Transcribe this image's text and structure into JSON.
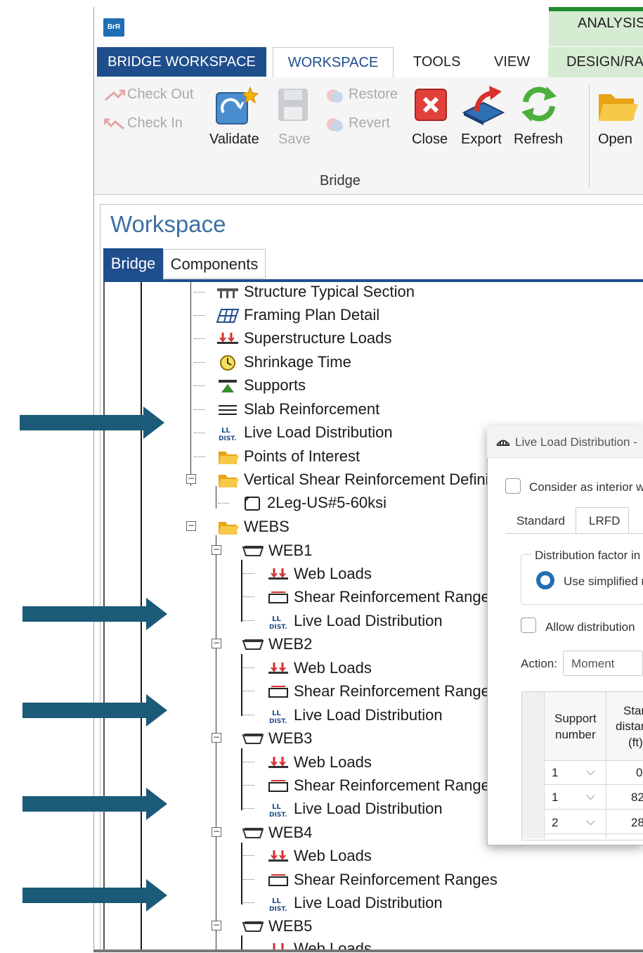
{
  "window": {
    "app_logo": "BrR",
    "analysis_tab": "ANALYSIS"
  },
  "ribbon": {
    "tabs": [
      "BRIDGE WORKSPACE",
      "WORKSPACE",
      "TOOLS",
      "VIEW",
      "DESIGN/RA"
    ],
    "check_out": "Check Out",
    "check_in": "Check In",
    "validate": "Validate",
    "save": "Save",
    "restore": "Restore",
    "revert": "Revert",
    "close": "Close",
    "export": "Export",
    "refresh": "Refresh",
    "open": "Open",
    "group_label": "Bridge"
  },
  "workspace": {
    "title": "Workspace",
    "tab_bridge": "Bridge",
    "tab_components": "Components"
  },
  "tree": {
    "structure_typical_section": "Structure Typical Section",
    "framing_plan_detail": "Framing Plan Detail",
    "superstructure_loads": "Superstructure Loads",
    "shrinkage_time": "Shrinkage Time",
    "supports": "Supports",
    "slab_reinforcement": "Slab Reinforcement",
    "live_load_distribution": "Live Load Distribution",
    "points_of_interest": "Points of Interest",
    "vertical_shear": "Vertical Shear Reinforcement Defini",
    "shear_item": "2Leg-US#5-60ksi",
    "webs": "WEBS",
    "web1": "WEB1",
    "web2": "WEB2",
    "web3": "WEB3",
    "web4": "WEB4",
    "web5": "WEB5",
    "web_loads": "Web Loads",
    "shear_ranges_cut": "Shear Reinforcement Range",
    "shear_ranges_full": "Shear Reinforcement Ranges",
    "web_loads_partial": "Web Loads"
  },
  "dialog": {
    "title": "Live Load Distribution -",
    "consider_interior": "Consider as interior w",
    "tab_standard": "Standard",
    "tab_lrfd": "LRFD",
    "group_label": "Distribution factor in",
    "radio_simplified": "Use simplified m",
    "allow_distribution": "Allow distribution",
    "action_label": "Action:",
    "action_value": "Moment",
    "col_support": [
      "Support",
      "number"
    ],
    "col_start": [
      "Star",
      "distan",
      "(ft)"
    ],
    "rows": [
      {
        "support": "1",
        "start": "0"
      },
      {
        "support": "1",
        "start": "82"
      },
      {
        "support": "2",
        "start": "28"
      }
    ]
  },
  "colors": {
    "ribbon_blue": "#1f4e8c",
    "analysis_green": "#d6ecd2",
    "arrow_teal": "#1b5a78",
    "workspace_title": "#3d6fa5"
  }
}
